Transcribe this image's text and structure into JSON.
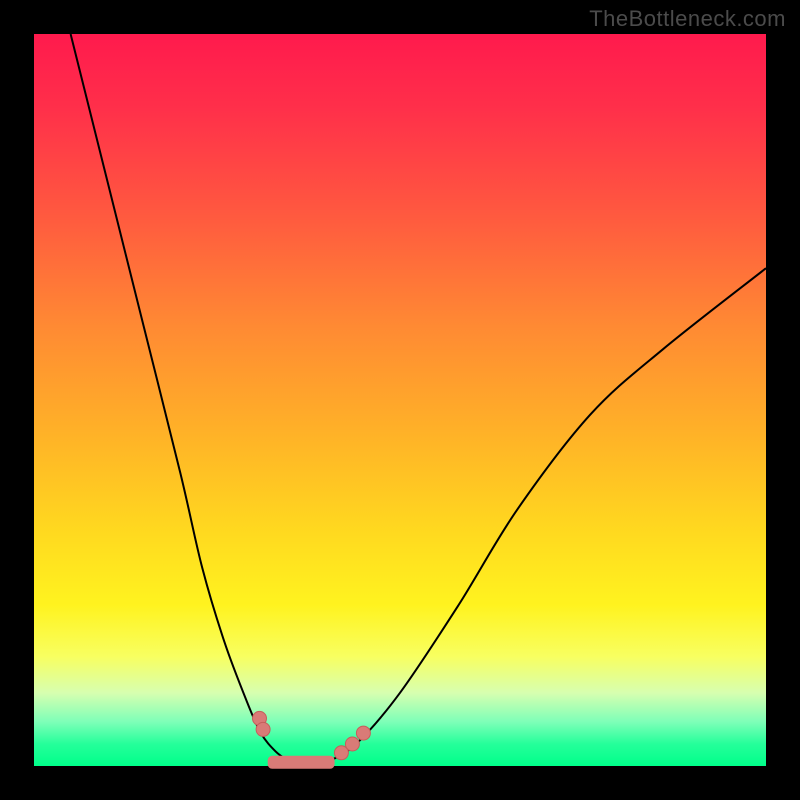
{
  "watermark": "TheBottleneck.com",
  "chart_data": {
    "type": "line",
    "title": "",
    "xlabel": "",
    "ylabel": "",
    "xlim": [
      0,
      100
    ],
    "ylim": [
      0,
      100
    ],
    "background_gradient": {
      "stops": [
        "#ff1a4d",
        "#ff5a3f",
        "#ffb327",
        "#fff31f",
        "#7dffb8",
        "#00ff8a"
      ]
    },
    "series": [
      {
        "name": "left-curve",
        "x": [
          5,
          10,
          15,
          20,
          23,
          26,
          29,
          31,
          33,
          35
        ],
        "y": [
          100,
          80,
          60,
          40,
          27,
          17,
          9,
          4.5,
          2,
          0.5
        ]
      },
      {
        "name": "right-curve",
        "x": [
          40,
          44,
          50,
          58,
          66,
          76,
          86,
          100
        ],
        "y": [
          0.5,
          3,
          10,
          22,
          35,
          48,
          57,
          68
        ]
      }
    ],
    "markers": [
      {
        "series": "left-curve",
        "x": 30.8,
        "y": 6.5
      },
      {
        "series": "left-curve",
        "x": 31.3,
        "y": 5.0
      },
      {
        "series": "right-curve",
        "x": 42.0,
        "y": 1.8
      },
      {
        "series": "right-curve",
        "x": 43.5,
        "y": 3.0
      },
      {
        "series": "right-curve",
        "x": 45.0,
        "y": 4.5
      }
    ],
    "valley_bar": {
      "x_start": 32,
      "x_end": 41,
      "y": 0.5
    }
  }
}
